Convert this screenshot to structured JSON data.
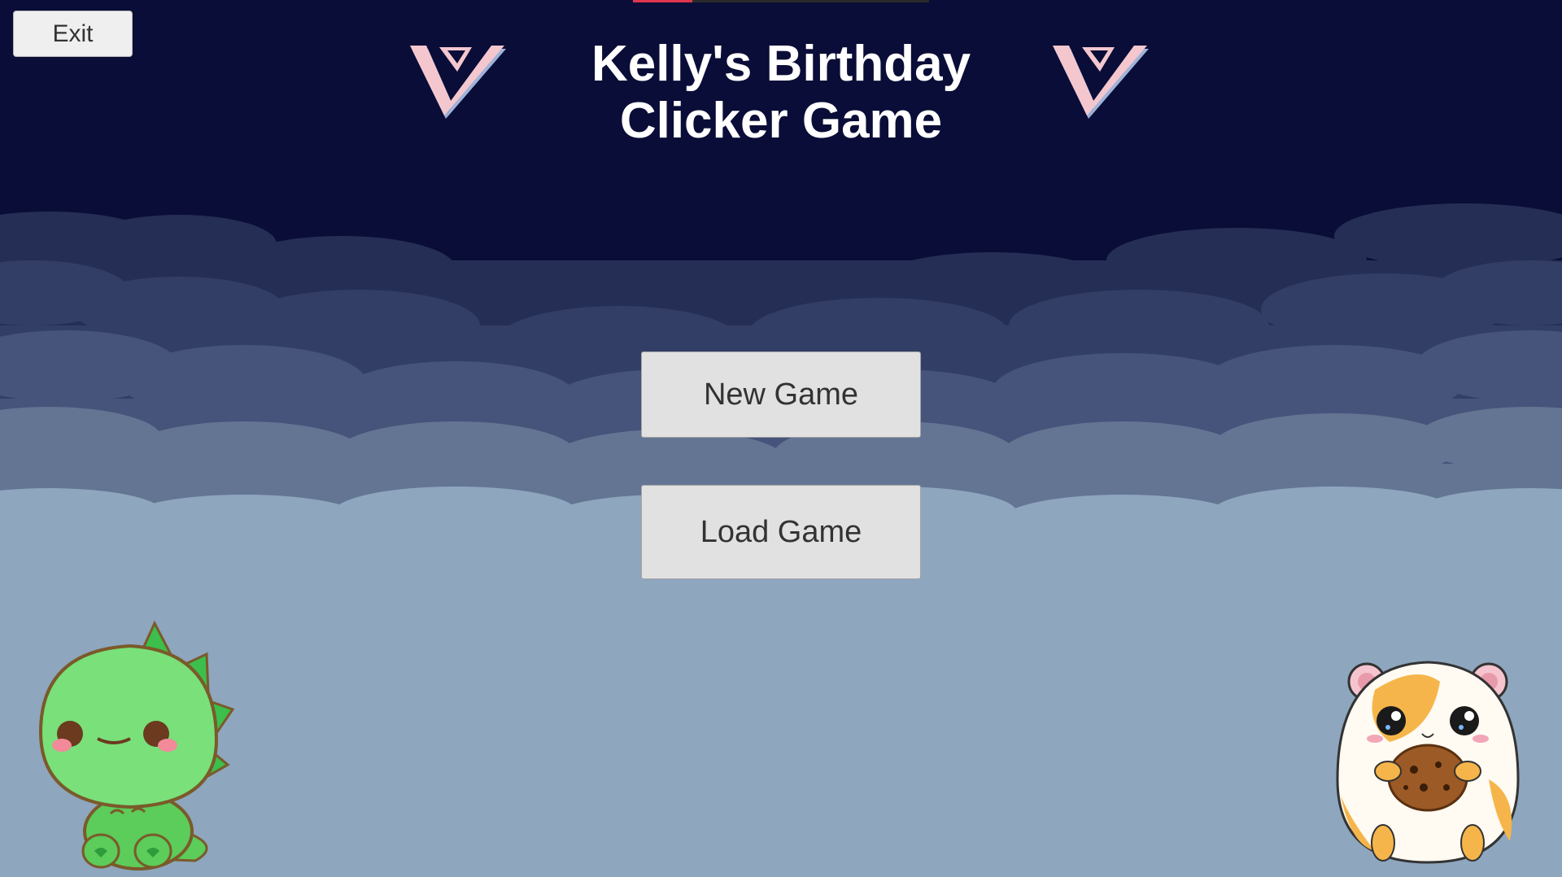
{
  "game": {
    "title_line1": "Kelly's Birthday",
    "title_line2": "Clicker Game"
  },
  "menu": {
    "exit_label": "Exit",
    "new_game_label": "New Game",
    "load_game_label": "Load Game"
  },
  "icons": {
    "logo": "seventeen-logo-icon",
    "left_character": "green-dinosaur-icon",
    "right_character": "hamster-with-cookie-icon"
  },
  "colors": {
    "sky_top": "#0a0d37",
    "cloud_dark": "#2f3a5e",
    "cloud_mid": "#4a5778",
    "cloud_light": "#6a7a98",
    "ground": "#8ea6be",
    "button_bg": "#e1e1e1",
    "logo_pink": "#f4c7cf",
    "logo_blue": "#9fb3d8"
  },
  "loading_progress": 0.2
}
